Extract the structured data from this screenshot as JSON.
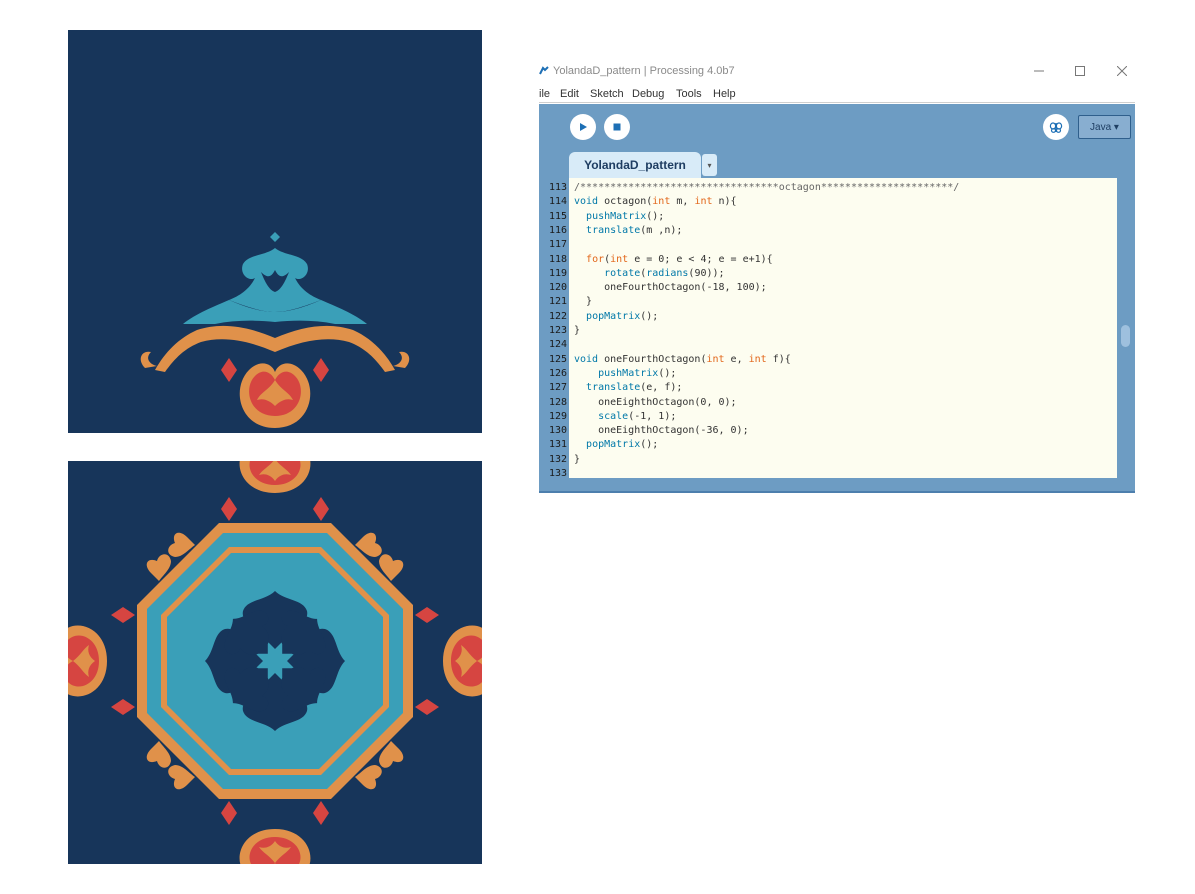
{
  "colors": {
    "canvas_bg": "#17355a",
    "orange": "#e0914a",
    "teal": "#3a9fb8",
    "red": "#d64541",
    "toolbar": "#6d9cc3",
    "editor_bg": "#fdfdf0",
    "keyword": "#e2661a",
    "function": "#0078a8"
  },
  "window": {
    "title": "YolandaD_pattern | Processing 4.0b7",
    "controls": [
      "minimize-icon",
      "maximize-icon",
      "close-icon"
    ]
  },
  "menu": [
    "ile",
    "Edit",
    "Sketch",
    "Debug",
    "Tools",
    "Help"
  ],
  "toolbar": {
    "run_icon": "play-icon",
    "stop_icon": "stop-icon",
    "debug_icon": "butterfly-icon",
    "mode_label": "Java ▾"
  },
  "tab": {
    "label": "YolandaD_pattern",
    "arrow": "▾"
  },
  "editor": {
    "lines": [
      {
        "num": "113",
        "tokens": [
          {
            "t": "/*********************************octagon**********************/",
            "c": "cm"
          }
        ]
      },
      {
        "num": "114",
        "tokens": [
          {
            "t": "void",
            "c": "fn"
          },
          {
            "t": " octagon(",
            "c": ""
          },
          {
            "t": "int",
            "c": "kw"
          },
          {
            "t": " m, ",
            "c": ""
          },
          {
            "t": "int",
            "c": "kw"
          },
          {
            "t": " n){",
            "c": ""
          }
        ]
      },
      {
        "num": "115",
        "tokens": [
          {
            "t": "  ",
            "c": ""
          },
          {
            "t": "pushMatrix",
            "c": "fn"
          },
          {
            "t": "();",
            "c": ""
          }
        ]
      },
      {
        "num": "116",
        "tokens": [
          {
            "t": "  ",
            "c": ""
          },
          {
            "t": "translate",
            "c": "fn"
          },
          {
            "t": "(m ,n);",
            "c": ""
          }
        ]
      },
      {
        "num": "117",
        "tokens": []
      },
      {
        "num": "118",
        "tokens": [
          {
            "t": "  ",
            "c": ""
          },
          {
            "t": "for",
            "c": "kw"
          },
          {
            "t": "(",
            "c": ""
          },
          {
            "t": "int",
            "c": "kw"
          },
          {
            "t": " e = 0; e < 4; e = e+1){",
            "c": ""
          }
        ]
      },
      {
        "num": "119",
        "tokens": [
          {
            "t": "     ",
            "c": ""
          },
          {
            "t": "rotate",
            "c": "fn"
          },
          {
            "t": "(",
            "c": ""
          },
          {
            "t": "radians",
            "c": "fn"
          },
          {
            "t": "(90));",
            "c": ""
          }
        ]
      },
      {
        "num": "120",
        "tokens": [
          {
            "t": "     oneFourthOctagon(-18, 100);",
            "c": ""
          }
        ]
      },
      {
        "num": "121",
        "tokens": [
          {
            "t": "  }",
            "c": ""
          }
        ]
      },
      {
        "num": "122",
        "tokens": [
          {
            "t": "  ",
            "c": ""
          },
          {
            "t": "popMatrix",
            "c": "fn"
          },
          {
            "t": "();",
            "c": ""
          }
        ]
      },
      {
        "num": "123",
        "tokens": [
          {
            "t": "}",
            "c": ""
          }
        ]
      },
      {
        "num": "124",
        "tokens": []
      },
      {
        "num": "125",
        "tokens": [
          {
            "t": "void",
            "c": "fn"
          },
          {
            "t": " oneFourthOctagon(",
            "c": ""
          },
          {
            "t": "int",
            "c": "kw"
          },
          {
            "t": " e, ",
            "c": ""
          },
          {
            "t": "int",
            "c": "kw"
          },
          {
            "t": " f){",
            "c": ""
          }
        ]
      },
      {
        "num": "126",
        "tokens": [
          {
            "t": "    ",
            "c": ""
          },
          {
            "t": "pushMatrix",
            "c": "fn"
          },
          {
            "t": "();",
            "c": ""
          }
        ]
      },
      {
        "num": "127",
        "tokens": [
          {
            "t": "  ",
            "c": ""
          },
          {
            "t": "translate",
            "c": "fn"
          },
          {
            "t": "(e, f);",
            "c": ""
          }
        ]
      },
      {
        "num": "128",
        "tokens": [
          {
            "t": "    oneEighthOctagon(0, 0);",
            "c": ""
          }
        ]
      },
      {
        "num": "129",
        "tokens": [
          {
            "t": "    ",
            "c": ""
          },
          {
            "t": "scale",
            "c": "fn"
          },
          {
            "t": "(-1, 1);",
            "c": ""
          }
        ]
      },
      {
        "num": "130",
        "tokens": [
          {
            "t": "    oneEighthOctagon(-36, 0);",
            "c": ""
          }
        ]
      },
      {
        "num": "131",
        "tokens": [
          {
            "t": "  ",
            "c": ""
          },
          {
            "t": "popMatrix",
            "c": "fn"
          },
          {
            "t": "();",
            "c": ""
          }
        ]
      },
      {
        "num": "132",
        "tokens": [
          {
            "t": "}",
            "c": ""
          }
        ]
      },
      {
        "num": "133",
        "tokens": []
      }
    ]
  }
}
